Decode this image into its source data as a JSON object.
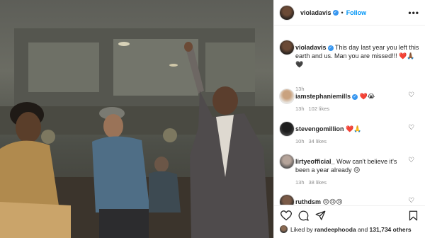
{
  "post": {
    "author": "violadavis",
    "follow_label": "Follow",
    "separator": "•",
    "more_label": "•••",
    "caption": {
      "user": "violadavis",
      "text": "This day last year you left this earth and us. Man you are missed!!! ❤️🙏🏾🖤",
      "time": "13h"
    }
  },
  "comments": [
    {
      "user": "iamstephaniemills",
      "text": "❤️😭",
      "time": "13h",
      "likes": "102 likes"
    },
    {
      "user": "stevengomillion",
      "text": "❤️🙏",
      "time": "10h",
      "likes": "34 likes"
    },
    {
      "user": "lirtyeofficial_",
      "text": "Wow can't believe it's been a year already 😢",
      "time": "13h",
      "likes": "38 likes"
    },
    {
      "user": "ruthdsm",
      "text": "😢😢😢",
      "time": "",
      "likes": ""
    }
  ],
  "footer": {
    "liked_prefix": "Liked by ",
    "liked_user": "randeephooda",
    "and_label": " and ",
    "others": "131,734 others"
  },
  "icons": {
    "heart": "heart-icon",
    "comment": "comment-icon",
    "share": "share-icon",
    "save": "bookmark-icon",
    "verified": "verified-badge-icon",
    "more": "more-options-icon"
  },
  "colors": {
    "link": "#0095f6",
    "verified": "#3897f0",
    "meta": "#8e8e8e"
  }
}
